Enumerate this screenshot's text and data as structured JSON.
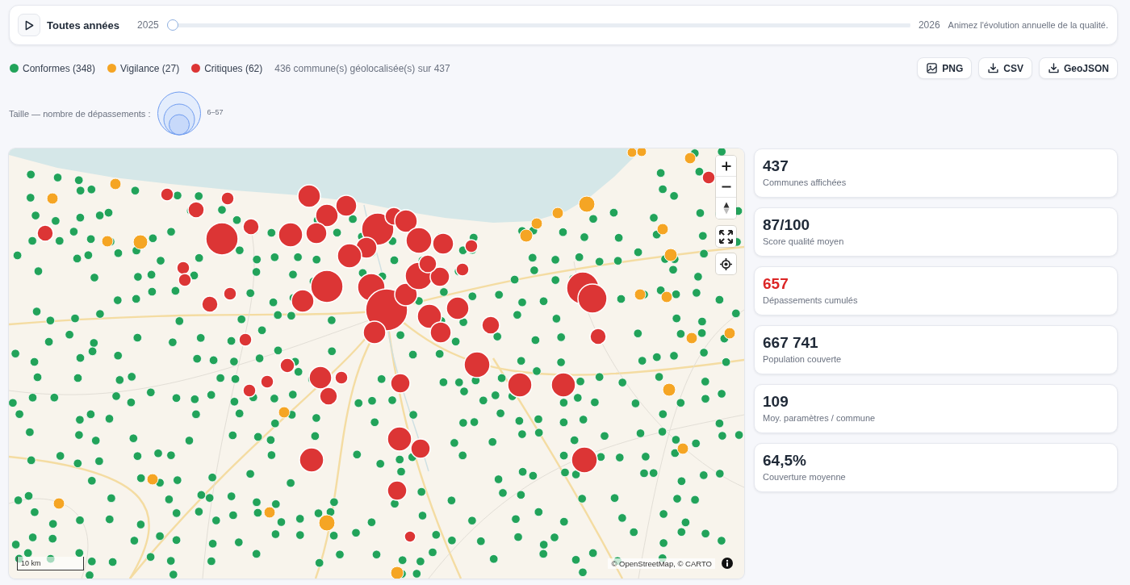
{
  "timeline": {
    "title": "Toutes années",
    "start_year": "2025",
    "end_year": "2026",
    "level": 0,
    "hint": "Animez l'évolution annuelle de la qualité."
  },
  "legend": [
    {
      "label": "Conformes (348)",
      "color": "#22a35a"
    },
    {
      "label": "Vigilance (27)",
      "color": "#f5a524"
    },
    {
      "label": "Critiques (62)",
      "color": "#dc3535"
    }
  ],
  "geolocated_summary": "436 commune(s) géolocalisée(s) sur 437",
  "export_buttons": [
    {
      "kind": "image",
      "label": "PNG"
    },
    {
      "kind": "download",
      "label": "CSV"
    },
    {
      "kind": "download",
      "label": "GeoJSON"
    }
  ],
  "size_legend": {
    "label": "Taille — nombre de dépassements :",
    "range": "6–57"
  },
  "map": {
    "scale": "10 km",
    "attribution": "© OpenStreetMap, © CARTO"
  },
  "stats": [
    {
      "value": "437",
      "label": "Communes affichées",
      "highlight": false
    },
    {
      "value": "87/100",
      "label": "Score qualité moyen",
      "highlight": false
    },
    {
      "value": "657",
      "label": "Dépassements cumulés",
      "highlight": true
    },
    {
      "value": "667 741",
      "label": "Population couverte",
      "highlight": false
    },
    {
      "value": "109",
      "label": "Moy. paramètres / commune",
      "highlight": false
    },
    {
      "value": "64,5%",
      "label": "Couverture moyenne",
      "highlight": false
    }
  ]
}
